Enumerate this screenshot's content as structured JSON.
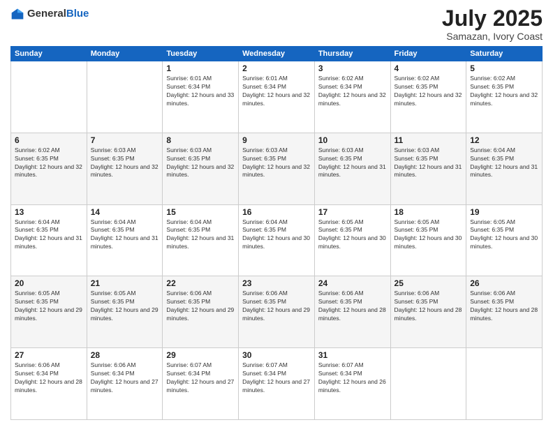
{
  "header": {
    "logo_general": "General",
    "logo_blue": "Blue",
    "month": "July 2025",
    "location": "Samazan, Ivory Coast"
  },
  "weekdays": [
    "Sunday",
    "Monday",
    "Tuesday",
    "Wednesday",
    "Thursday",
    "Friday",
    "Saturday"
  ],
  "weeks": [
    [
      {
        "day": "",
        "sunrise": "",
        "sunset": "",
        "daylight": ""
      },
      {
        "day": "",
        "sunrise": "",
        "sunset": "",
        "daylight": ""
      },
      {
        "day": "1",
        "sunrise": "Sunrise: 6:01 AM",
        "sunset": "Sunset: 6:34 PM",
        "daylight": "Daylight: 12 hours and 33 minutes."
      },
      {
        "day": "2",
        "sunrise": "Sunrise: 6:01 AM",
        "sunset": "Sunset: 6:34 PM",
        "daylight": "Daylight: 12 hours and 32 minutes."
      },
      {
        "day": "3",
        "sunrise": "Sunrise: 6:02 AM",
        "sunset": "Sunset: 6:34 PM",
        "daylight": "Daylight: 12 hours and 32 minutes."
      },
      {
        "day": "4",
        "sunrise": "Sunrise: 6:02 AM",
        "sunset": "Sunset: 6:35 PM",
        "daylight": "Daylight: 12 hours and 32 minutes."
      },
      {
        "day": "5",
        "sunrise": "Sunrise: 6:02 AM",
        "sunset": "Sunset: 6:35 PM",
        "daylight": "Daylight: 12 hours and 32 minutes."
      }
    ],
    [
      {
        "day": "6",
        "sunrise": "Sunrise: 6:02 AM",
        "sunset": "Sunset: 6:35 PM",
        "daylight": "Daylight: 12 hours and 32 minutes."
      },
      {
        "day": "7",
        "sunrise": "Sunrise: 6:03 AM",
        "sunset": "Sunset: 6:35 PM",
        "daylight": "Daylight: 12 hours and 32 minutes."
      },
      {
        "day": "8",
        "sunrise": "Sunrise: 6:03 AM",
        "sunset": "Sunset: 6:35 PM",
        "daylight": "Daylight: 12 hours and 32 minutes."
      },
      {
        "day": "9",
        "sunrise": "Sunrise: 6:03 AM",
        "sunset": "Sunset: 6:35 PM",
        "daylight": "Daylight: 12 hours and 32 minutes."
      },
      {
        "day": "10",
        "sunrise": "Sunrise: 6:03 AM",
        "sunset": "Sunset: 6:35 PM",
        "daylight": "Daylight: 12 hours and 31 minutes."
      },
      {
        "day": "11",
        "sunrise": "Sunrise: 6:03 AM",
        "sunset": "Sunset: 6:35 PM",
        "daylight": "Daylight: 12 hours and 31 minutes."
      },
      {
        "day": "12",
        "sunrise": "Sunrise: 6:04 AM",
        "sunset": "Sunset: 6:35 PM",
        "daylight": "Daylight: 12 hours and 31 minutes."
      }
    ],
    [
      {
        "day": "13",
        "sunrise": "Sunrise: 6:04 AM",
        "sunset": "Sunset: 6:35 PM",
        "daylight": "Daylight: 12 hours and 31 minutes."
      },
      {
        "day": "14",
        "sunrise": "Sunrise: 6:04 AM",
        "sunset": "Sunset: 6:35 PM",
        "daylight": "Daylight: 12 hours and 31 minutes."
      },
      {
        "day": "15",
        "sunrise": "Sunrise: 6:04 AM",
        "sunset": "Sunset: 6:35 PM",
        "daylight": "Daylight: 12 hours and 31 minutes."
      },
      {
        "day": "16",
        "sunrise": "Sunrise: 6:04 AM",
        "sunset": "Sunset: 6:35 PM",
        "daylight": "Daylight: 12 hours and 30 minutes."
      },
      {
        "day": "17",
        "sunrise": "Sunrise: 6:05 AM",
        "sunset": "Sunset: 6:35 PM",
        "daylight": "Daylight: 12 hours and 30 minutes."
      },
      {
        "day": "18",
        "sunrise": "Sunrise: 6:05 AM",
        "sunset": "Sunset: 6:35 PM",
        "daylight": "Daylight: 12 hours and 30 minutes."
      },
      {
        "day": "19",
        "sunrise": "Sunrise: 6:05 AM",
        "sunset": "Sunset: 6:35 PM",
        "daylight": "Daylight: 12 hours and 30 minutes."
      }
    ],
    [
      {
        "day": "20",
        "sunrise": "Sunrise: 6:05 AM",
        "sunset": "Sunset: 6:35 PM",
        "daylight": "Daylight: 12 hours and 29 minutes."
      },
      {
        "day": "21",
        "sunrise": "Sunrise: 6:05 AM",
        "sunset": "Sunset: 6:35 PM",
        "daylight": "Daylight: 12 hours and 29 minutes."
      },
      {
        "day": "22",
        "sunrise": "Sunrise: 6:06 AM",
        "sunset": "Sunset: 6:35 PM",
        "daylight": "Daylight: 12 hours and 29 minutes."
      },
      {
        "day": "23",
        "sunrise": "Sunrise: 6:06 AM",
        "sunset": "Sunset: 6:35 PM",
        "daylight": "Daylight: 12 hours and 29 minutes."
      },
      {
        "day": "24",
        "sunrise": "Sunrise: 6:06 AM",
        "sunset": "Sunset: 6:35 PM",
        "daylight": "Daylight: 12 hours and 28 minutes."
      },
      {
        "day": "25",
        "sunrise": "Sunrise: 6:06 AM",
        "sunset": "Sunset: 6:35 PM",
        "daylight": "Daylight: 12 hours and 28 minutes."
      },
      {
        "day": "26",
        "sunrise": "Sunrise: 6:06 AM",
        "sunset": "Sunset: 6:35 PM",
        "daylight": "Daylight: 12 hours and 28 minutes."
      }
    ],
    [
      {
        "day": "27",
        "sunrise": "Sunrise: 6:06 AM",
        "sunset": "Sunset: 6:34 PM",
        "daylight": "Daylight: 12 hours and 28 minutes."
      },
      {
        "day": "28",
        "sunrise": "Sunrise: 6:06 AM",
        "sunset": "Sunset: 6:34 PM",
        "daylight": "Daylight: 12 hours and 27 minutes."
      },
      {
        "day": "29",
        "sunrise": "Sunrise: 6:07 AM",
        "sunset": "Sunset: 6:34 PM",
        "daylight": "Daylight: 12 hours and 27 minutes."
      },
      {
        "day": "30",
        "sunrise": "Sunrise: 6:07 AM",
        "sunset": "Sunset: 6:34 PM",
        "daylight": "Daylight: 12 hours and 27 minutes."
      },
      {
        "day": "31",
        "sunrise": "Sunrise: 6:07 AM",
        "sunset": "Sunset: 6:34 PM",
        "daylight": "Daylight: 12 hours and 26 minutes."
      },
      {
        "day": "",
        "sunrise": "",
        "sunset": "",
        "daylight": ""
      },
      {
        "day": "",
        "sunrise": "",
        "sunset": "",
        "daylight": ""
      }
    ]
  ]
}
